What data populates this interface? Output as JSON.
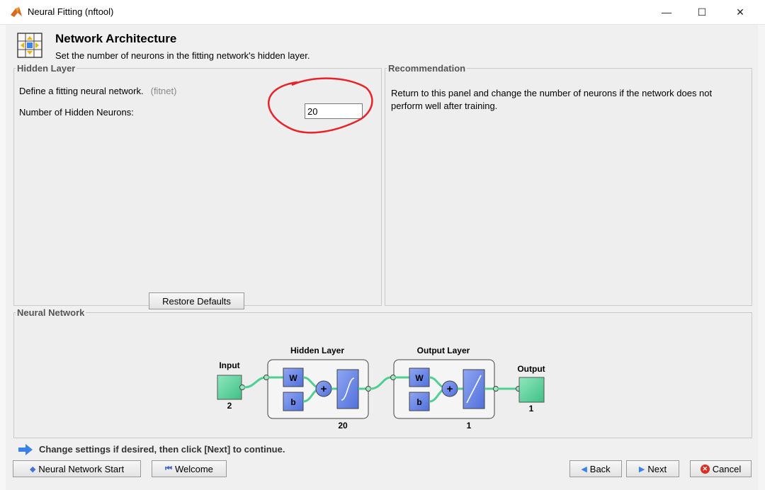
{
  "window": {
    "title": "Neural Fitting (nftool)",
    "controls": {
      "minimize": "—",
      "maximize": "☐",
      "close": "✕"
    }
  },
  "header": {
    "title": "Network Architecture",
    "subtitle": "Set the number of neurons in the fitting network's hidden layer."
  },
  "hidden_layer_panel": {
    "legend": "Hidden Layer",
    "define_text": "Define a fitting neural network.",
    "define_tag": "(fitnet)",
    "neurons_label": "Number of Hidden Neurons:",
    "neurons_value": "20",
    "restore_button": "Restore Defaults"
  },
  "recommendation_panel": {
    "legend": "Recommendation",
    "text": "Return to this panel and change the number of neurons if the network does not perform well after training."
  },
  "network_panel": {
    "legend": "Neural Network",
    "input_label": "Input",
    "input_size": "2",
    "hidden_layer_label": "Hidden Layer",
    "hidden_size": "20",
    "output_layer_label": "Output Layer",
    "output_layer_size": "1",
    "output_label": "Output",
    "output_size": "1",
    "weight_label": "W",
    "bias_label": "b",
    "sum_symbol": "+"
  },
  "footer": {
    "hint": "Change settings  if desired, then click [Next] to continue.",
    "buttons": {
      "start": "Neural Network Start",
      "welcome": "Welcome",
      "back": "Back",
      "next": "Next",
      "cancel": "Cancel"
    }
  },
  "icons": {
    "app": "matlab-logo-icon",
    "header": "network-architecture-icon",
    "hint": "right-arrow-icon",
    "start": "neural-network-start-icon",
    "welcome": "welcome-icon",
    "back": "back-arrow-icon",
    "next": "next-arrow-icon",
    "cancel": "cancel-icon"
  },
  "colors": {
    "node_fill": "#5fd19c",
    "layer_fill": "#6b86e6",
    "highlight": "#e8242a",
    "hint_arrow": "#3b82e6",
    "cancel_icon": "#d93025"
  }
}
